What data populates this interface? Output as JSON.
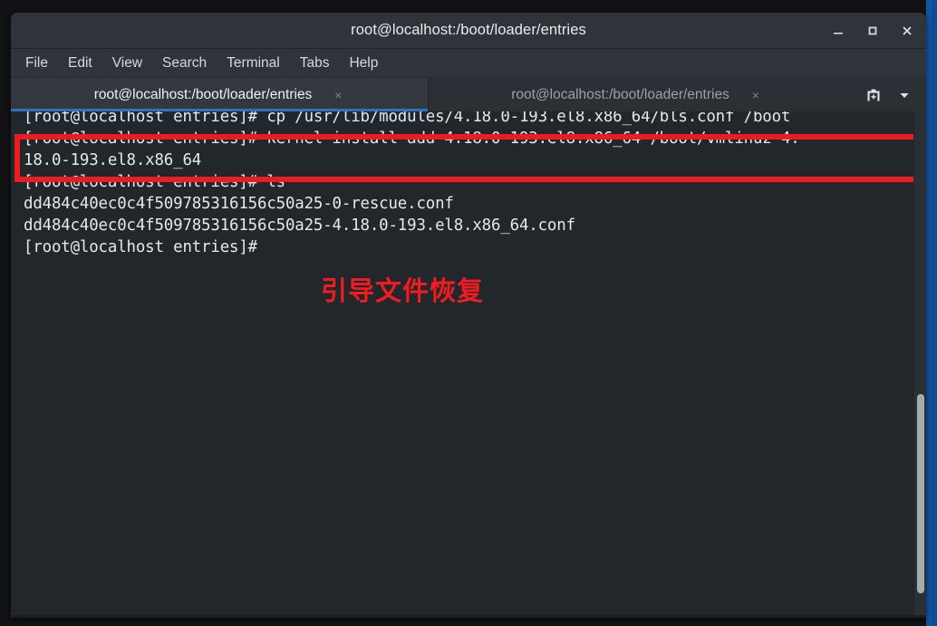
{
  "window": {
    "title": "root@localhost:/boot/loader/entries",
    "controls": [
      {
        "name": "minimize",
        "glyph": "–"
      },
      {
        "name": "maximize",
        "glyph": "□"
      },
      {
        "name": "close",
        "glyph": "✕"
      }
    ]
  },
  "menubar": {
    "items": [
      {
        "label": "File"
      },
      {
        "label": "Edit"
      },
      {
        "label": "View"
      },
      {
        "label": "Search"
      },
      {
        "label": "Terminal"
      },
      {
        "label": "Tabs"
      },
      {
        "label": "Help"
      }
    ]
  },
  "tabbar": {
    "tabs": [
      {
        "label": "root@localhost:/boot/loader/entries",
        "close": "×",
        "active": true
      },
      {
        "label": "root@localhost:/boot/loader/entries",
        "close": "×",
        "active": false
      }
    ],
    "controls": [
      {
        "name": "new-tab-icon"
      },
      {
        "name": "chevron-down-icon"
      }
    ]
  },
  "terminal": {
    "lines": [
      "[root@localhost entries]# cp /usr/lib/modules/4.18.0-193.el8.x86_64/bls.conf /boot",
      "[root@localhost entries]# kernel-install add 4.18.0-193.el8.x86_64 /boot/vmlinuz-4.",
      "18.0-193.el8.x86_64",
      "[root@localhost entries]# ls",
      "dd484c40ec0c4f509785316156c50a25-0-rescue.conf",
      "dd484c40ec0c4f509785316156c50a25-4.18.0-193.el8.x86_64.conf",
      "[root@localhost entries]#"
    ]
  },
  "annotation": {
    "caption": "引导文件恢复",
    "box_color": "#ee1c22",
    "caption_color": "#f01c22"
  },
  "colors": {
    "terminal_background": "#22272b",
    "titlebar_background": "#2f343a",
    "tab_active_underline": "#2a72c8",
    "desktop_accent": "#1257a4",
    "terminal_text": "#e6e8e9"
  }
}
